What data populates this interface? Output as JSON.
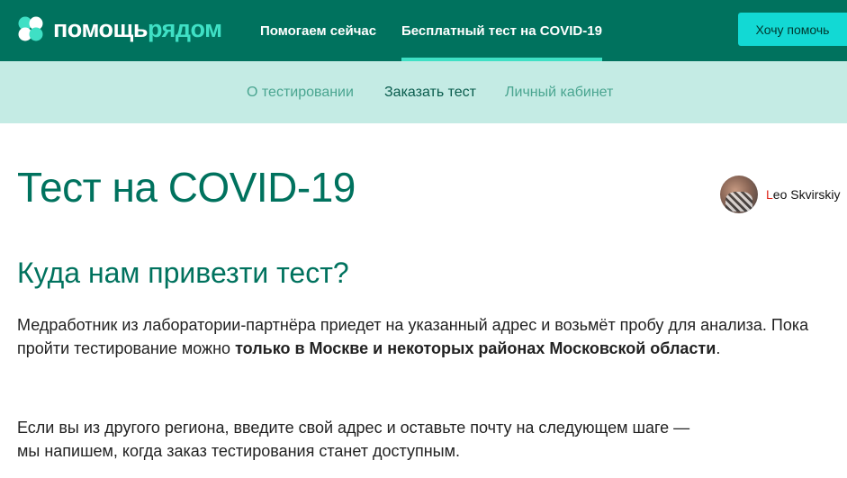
{
  "header": {
    "logo": {
      "part1": "помощь",
      "part2": "рядом"
    },
    "nav": [
      {
        "label": "Помогаем сейчас",
        "active": false
      },
      {
        "label": "Бесплатный тест на COVID-19",
        "active": true
      }
    ],
    "cta_label": "Хочу помочь"
  },
  "subnav": [
    {
      "label": "О тестировании",
      "active": false
    },
    {
      "label": "Заказать тест",
      "active": true
    },
    {
      "label": "Личный кабинет",
      "active": false
    }
  ],
  "user": {
    "initial": "L",
    "rest": "eo Skvirskiy"
  },
  "main": {
    "title": "Тест на COVID-19",
    "section_title": "Куда нам привезти тест?",
    "p1_before": "Медработник из лаборатории-партнёра приедет на указанный адрес и возьмёт пробу для анализа. Пока пройти тестирование можно ",
    "p1_bold": "только в Москве и некоторых районах Московской области",
    "p1_after": ".",
    "p2_line1": "Если вы из другого региона, введите свой адрес и оставьте почту на следующем шаге —",
    "p2_line2": "мы напишем, когда заказ тестирования станет доступным."
  },
  "colors": {
    "header_bg": "#00725e",
    "accent": "#3fe0c5",
    "cta_bg": "#12d9d4",
    "subnav_bg": "#c4ebe4",
    "title": "#00725e"
  }
}
